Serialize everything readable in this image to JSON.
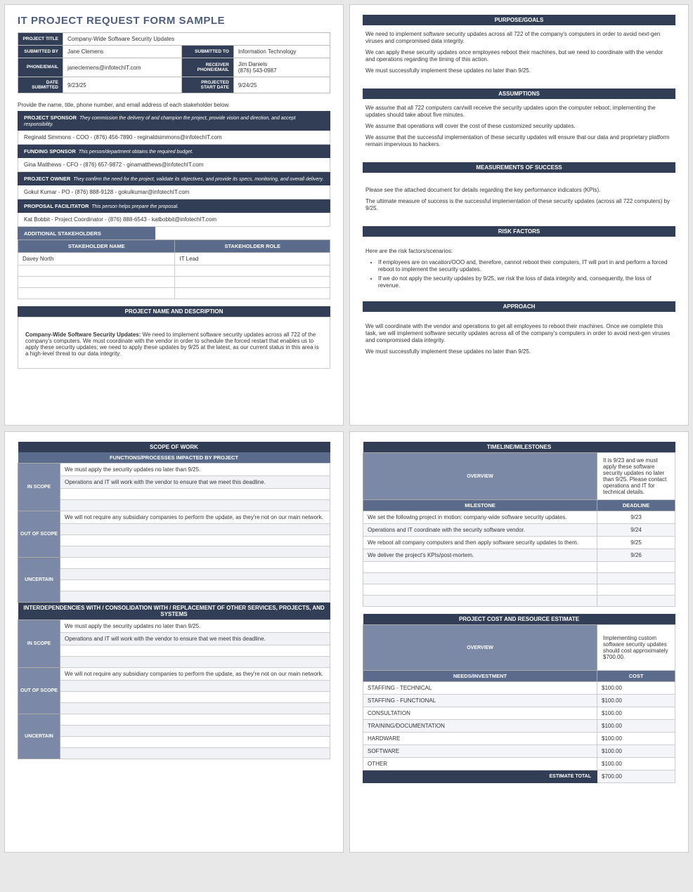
{
  "title": "IT PROJECT REQUEST FORM SAMPLE",
  "header": {
    "labels": {
      "project_title": "PROJECT TITLE",
      "submitted_by": "SUBMITTED BY",
      "submitted_to": "SUBMITTED TO",
      "phone_email": "PHONE/EMAIL",
      "receiver_phone_email": "RECEIVER PHONE/EMAIL",
      "date_submitted": "DATE SUBMITTED",
      "projected_start_date": "PROJECTED START DATE"
    },
    "values": {
      "project_title": "Company-Wide Software Security Updates",
      "submitted_by": "Jane Clemens",
      "submitted_to": "Information Technology",
      "phone_email": "janeclemens@infotechIT.com",
      "receiver": "Jim Daniels\n(876) 543-0987",
      "date_submitted": "9/23/25",
      "projected_start_date": "9/24/25"
    }
  },
  "stakeholder_note": "Provide the name, title, phone number, and email address of each stakeholder below.",
  "roles": {
    "sponsor": {
      "label": "PROJECT SPONSOR",
      "desc": "They commission the delivery of and champion the project, provide vision and direction, and accept responsibility.",
      "value": "Reginald Simmons - COO - (876) 456-7890 - reginaldsimmons@infotechIT.com"
    },
    "funding": {
      "label": "FUNDING SPONSOR",
      "desc": "This person/department obtains the required budget.",
      "value": "Gina Matthews - CFO - (876) 657-9872 - ginamatthews@infotechIT.com"
    },
    "owner": {
      "label": "PROJECT OWNER",
      "desc": "They confirm the need for the project, validate its objectives, and provide its specs, monitoring, and overall delivery.",
      "value": "Gokul Kumar - PO - (876) 888-9128 - gokulkumar@infotechIT.com"
    },
    "facilitator": {
      "label": "PROPOSAL FACILITATOR",
      "desc": "This person helps prepare the proposal.",
      "value": "Kat Bobbit - Project Coordinator - (876) 888-6543 - katbobbit@infotechIT.com"
    }
  },
  "additional_stakeholders": {
    "label": "ADDITIONAL STAKEHOLDERS",
    "cols": {
      "name": "STAKEHOLDER NAME",
      "role": "STAKEHOLDER ROLE"
    },
    "rows": [
      {
        "name": "Davey North",
        "role": "IT Lead"
      },
      {
        "name": "",
        "role": ""
      },
      {
        "name": "",
        "role": ""
      },
      {
        "name": "",
        "role": ""
      }
    ]
  },
  "project_desc": {
    "label": "PROJECT NAME AND DESCRIPTION",
    "bold": "Company-Wide Software Security Updates:",
    "text": " We need to implement software security updates across all 722 of the company's computers. We must coordinate with the vendor in order to schedule the forced restart that enables us to apply these security updates; we need to apply these updates by 9/25 at the latest, as our current status in this area is a high-level threat to our data integrity."
  },
  "narrative": {
    "purpose": {
      "label": "PURPOSE/GOALS",
      "paras": [
        "We need to implement software security updates across all 722 of the company's computers in order to avoid next-gen viruses and compromised data integrity.",
        "We can apply these security updates once employees reboot their machines, but we need to coordinate with the vendor and operations regarding the timing of this action.",
        "We must successfully implement these updates no later than 9/25."
      ]
    },
    "assumptions": {
      "label": "ASSUMPTIONS",
      "paras": [
        "We assume that all 722 computers can/will receive the security updates upon the computer reboot; implementing the updates should take about five minutes.",
        "We assume that operations will cover the cost of these customized security updates.",
        "We assume that the successful implementation of these security updates will ensure that our data and proprietary platform remain impervious to hackers."
      ]
    },
    "success": {
      "label": "MEASUREMENTS OF SUCCESS",
      "paras": [
        "Please see the attached document for details regarding the key performance indicators (KPIs).",
        "The ultimate measure of success is the successful implementation of these security updates (across all 722 computers) by 9/25."
      ]
    },
    "risk": {
      "label": "RISK FACTORS",
      "intro": "Here are the risk factors/scenarios:",
      "bullets": [
        "If employees are on vacation/OOO and, therefore, cannot reboot their computers, IT will port in and perform a forced reboot to implement the security updates.",
        "If we do not apply the security updates by 9/25, we risk the loss of data integrity and, consequently, the loss of revenue."
      ]
    },
    "approach": {
      "label": "APPROACH",
      "paras": [
        "We will coordinate with the vendor and operations to get all employees to reboot their machines. Once we complete this task, we will implement software security updates across all of the company's computers in order to avoid next-gen viruses and compromised data integrity.",
        "We must successfully implement these updates no later than 9/25."
      ]
    }
  },
  "scope": {
    "title": "SCOPE OF WORK",
    "sub1": "FUNCTIONS/PROCESSES IMPACTED BY PROJECT",
    "sub2": "INTERDEPENDENCIES WITH / CONSOLIDATION WITH / REPLACEMENT OF OTHER SERVICES, PROJECTS, AND SYSTEMS",
    "labels": {
      "in": "IN SCOPE",
      "out": "OUT OF SCOPE",
      "unc": "UNCERTAIN"
    },
    "g1": {
      "in": [
        "We must apply the security updates no later than 9/25.",
        "Operations and IT will work with the vendor to ensure that we meet this deadline.",
        "",
        ""
      ],
      "out": [
        "We will not require any subsidiary companies to perform the update, as they're not on our main network.",
        "",
        "",
        ""
      ],
      "unc": [
        "",
        "",
        "",
        ""
      ]
    },
    "g2": {
      "in": [
        "We must apply the security updates no later than 9/25.",
        "Operations and IT will work with the vendor to ensure that we meet this deadline.",
        "",
        ""
      ],
      "out": [
        "We will not require any subsidiary companies to perform the update, as they're not on our main network.",
        "",
        "",
        ""
      ],
      "unc": [
        "",
        "",
        "",
        ""
      ]
    }
  },
  "timeline": {
    "title": "TIMELINE/MILESTONES",
    "overview_label": "OVERVIEW",
    "overview": "It is 9/23 and we must apply these software security updates no later than 9/25. Please contact operations and IT for technical details.",
    "cols": {
      "m": "MILESTONE",
      "d": "DEADLINE"
    },
    "rows": [
      {
        "m": "We set the following project in motion: company-wide software security updates.",
        "d": "9/23"
      },
      {
        "m": "Operations and IT coordinate with the security software vendor.",
        "d": "9/24"
      },
      {
        "m": "We reboot all company computers and then apply software security updates to them.",
        "d": "9/25"
      },
      {
        "m": "We deliver the project's KPIs/post-mortem.",
        "d": "9/26"
      },
      {
        "m": "",
        "d": ""
      },
      {
        "m": "",
        "d": ""
      },
      {
        "m": "",
        "d": ""
      },
      {
        "m": "",
        "d": ""
      }
    ]
  },
  "cost": {
    "title": "PROJECT COST AND RESOURCE ESTIMATE",
    "overview_label": "OVERVIEW",
    "overview": "Implementing custom software security updates should cost approximately $700.00.",
    "cols": {
      "n": "NEEDS/INVESTMENT",
      "c": "COST"
    },
    "rows": [
      {
        "n": "STAFFING - TECHNICAL",
        "c": "$100.00"
      },
      {
        "n": "STAFFING - FUNCTIONAL",
        "c": "$100.00"
      },
      {
        "n": "CONSULTATION",
        "c": "$100.00"
      },
      {
        "n": "TRAINING/DOCUMENTATION",
        "c": "$100.00"
      },
      {
        "n": "HARDWARE",
        "c": "$100.00"
      },
      {
        "n": "SOFTWARE",
        "c": "$100.00"
      },
      {
        "n": "OTHER",
        "c": "$100.00"
      }
    ],
    "total_label": "ESTIMATE TOTAL",
    "total": "$700.00"
  }
}
